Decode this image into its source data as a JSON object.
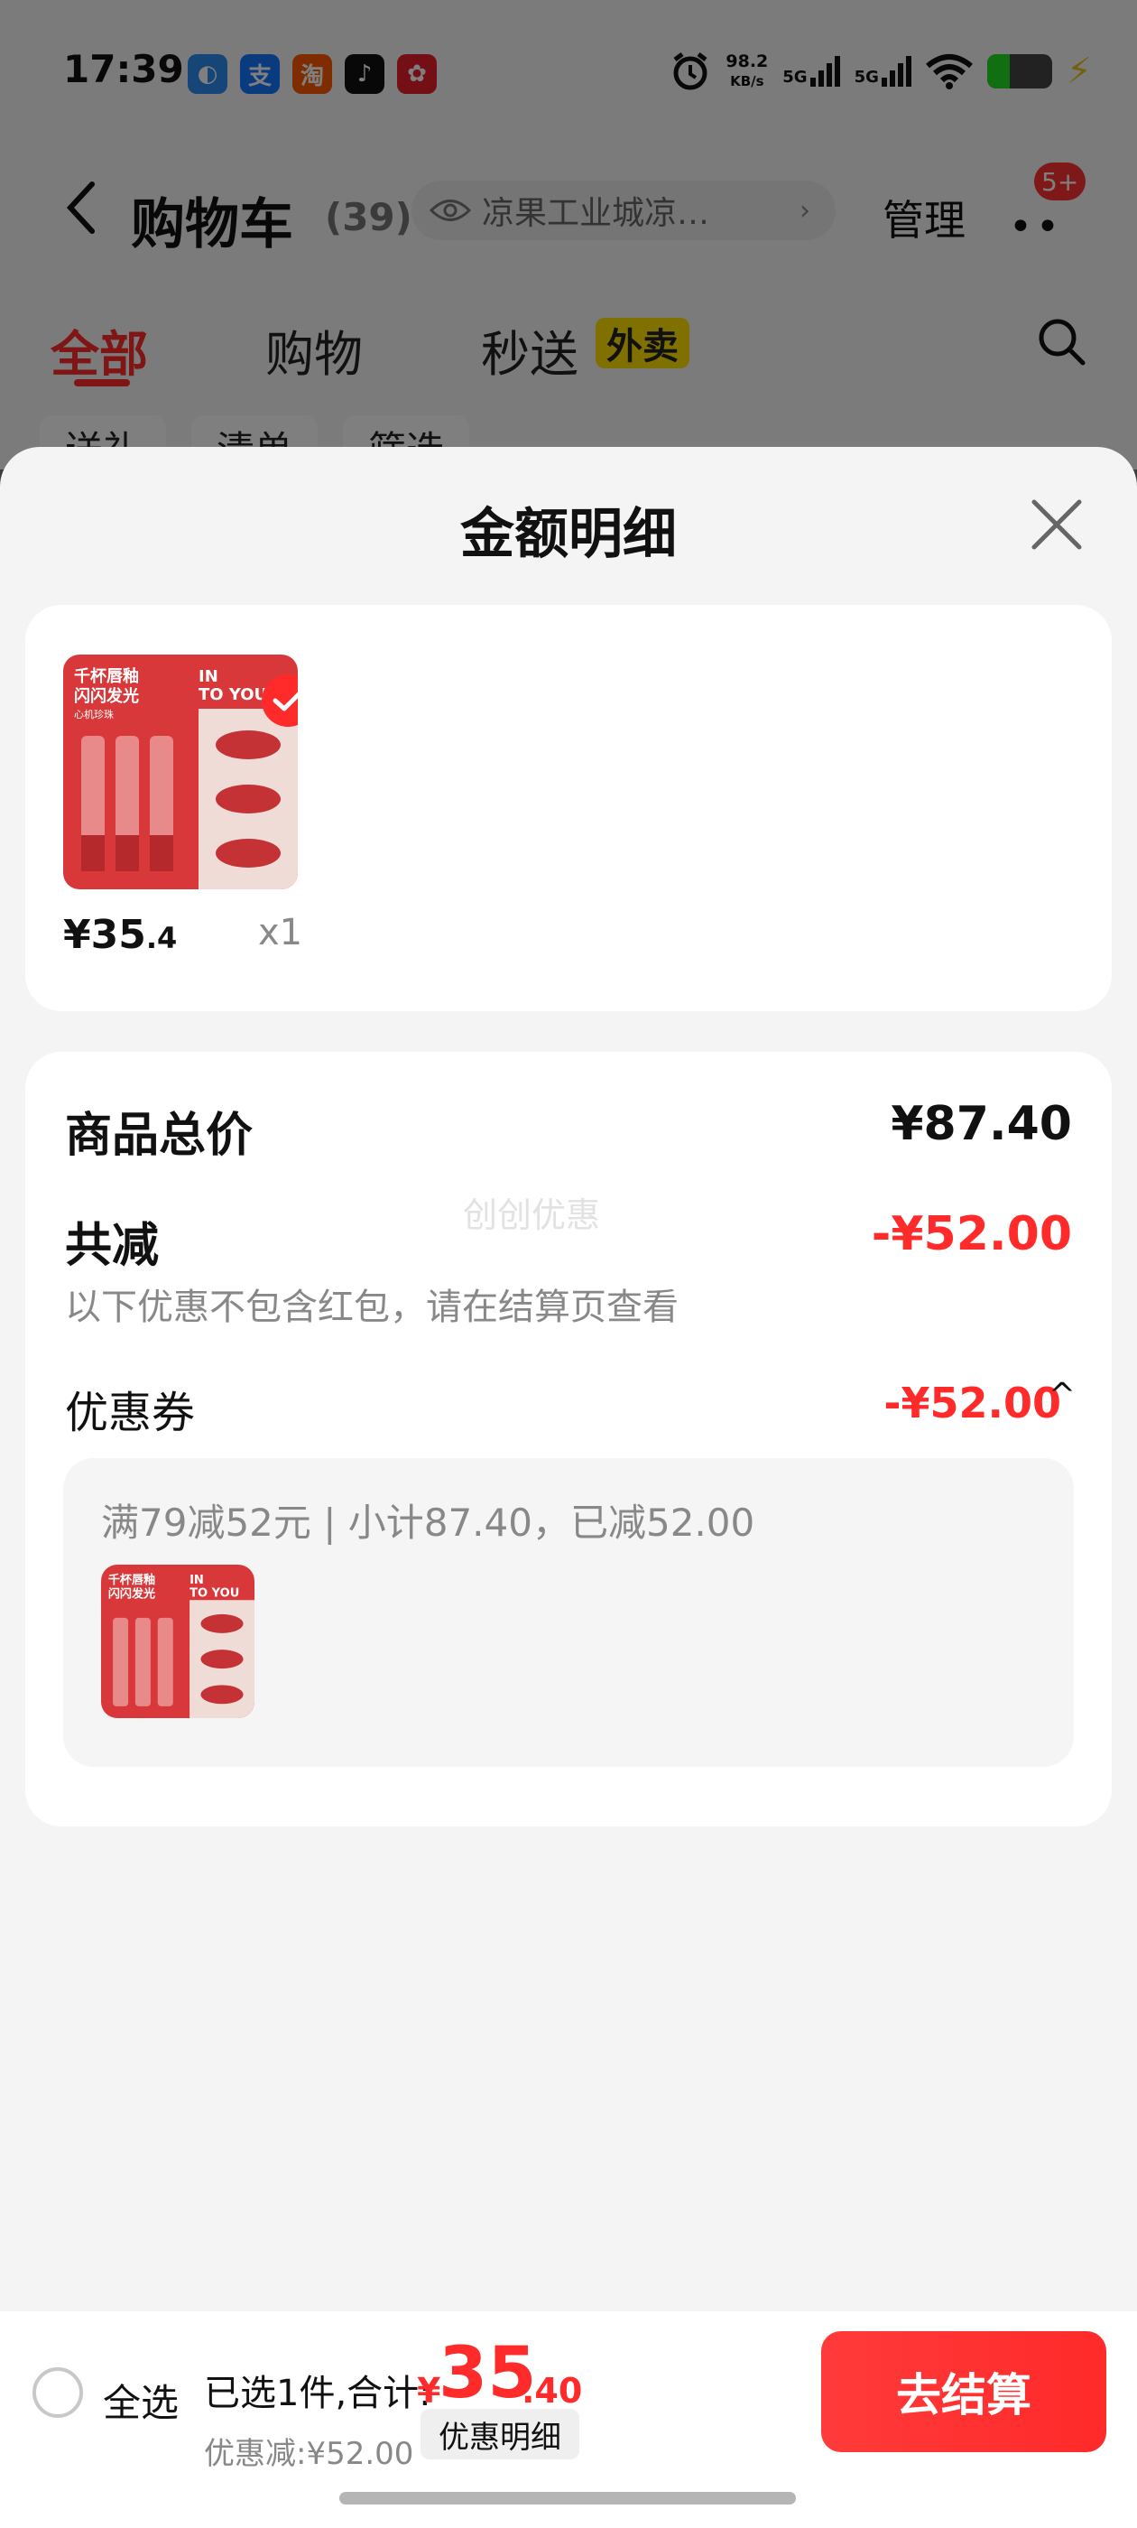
{
  "status_bar": {
    "time": "17:39",
    "net_speed_value": "98.2",
    "net_speed_unit": "KB/s",
    "signal1_label": "5G",
    "signal2_label": "5G",
    "battery_level": 0.35,
    "notification_icons": [
      "sensor-icon",
      "alipay-icon",
      "taobao-icon",
      "tiktok-icon",
      "promo-app-icon"
    ]
  },
  "nav": {
    "title": "购物车",
    "count": "(39)",
    "address": "凉果工业城凉…",
    "address_arrow": "›",
    "manage": "管理",
    "more_badge": "5+"
  },
  "tabs": [
    {
      "label": "全部",
      "active": true
    },
    {
      "label": "购物",
      "active": false
    },
    {
      "label": "秒送",
      "active": false
    }
  ],
  "tab_badge": "外卖",
  "filter_chips": [
    "送礼",
    "清单",
    "筛选"
  ],
  "sheet": {
    "title": "金额明细",
    "product": {
      "price_yen": "¥",
      "price_int": "35",
      "price_dec": ".4",
      "quantity": "x1",
      "image_text_cn": "千杯唇釉 闪闪发光",
      "image_text_en": "IN TO YOU",
      "image_sub": "心机珍珠 开盖唇釉"
    },
    "summary": {
      "total_label": "商品总价",
      "total_value": "¥87.40",
      "reduce_label": "共减",
      "reduce_value": "-¥52.00",
      "note": "以下优惠不包含红包，请在结算页查看",
      "watermark": "创创优惠",
      "coupon_label": "优惠券",
      "coupon_value": "-¥52.00",
      "coupon_chevron": "^",
      "coupon_desc": "满79减52元 | 小计87.40，已减52.00"
    }
  },
  "bottom_bar": {
    "select_all": "全选",
    "selected_text": "已选1件,合计:",
    "total_yen": "¥",
    "total_int": "35",
    "total_dec": ".40",
    "discount_text": "优惠减:¥52.00",
    "detail_button": "优惠明细",
    "checkout_button": "去结算"
  },
  "colors": {
    "accent": "#ff2a2a",
    "tab_badge_bg": "#ffe000",
    "battery_green": "#22dd22"
  }
}
